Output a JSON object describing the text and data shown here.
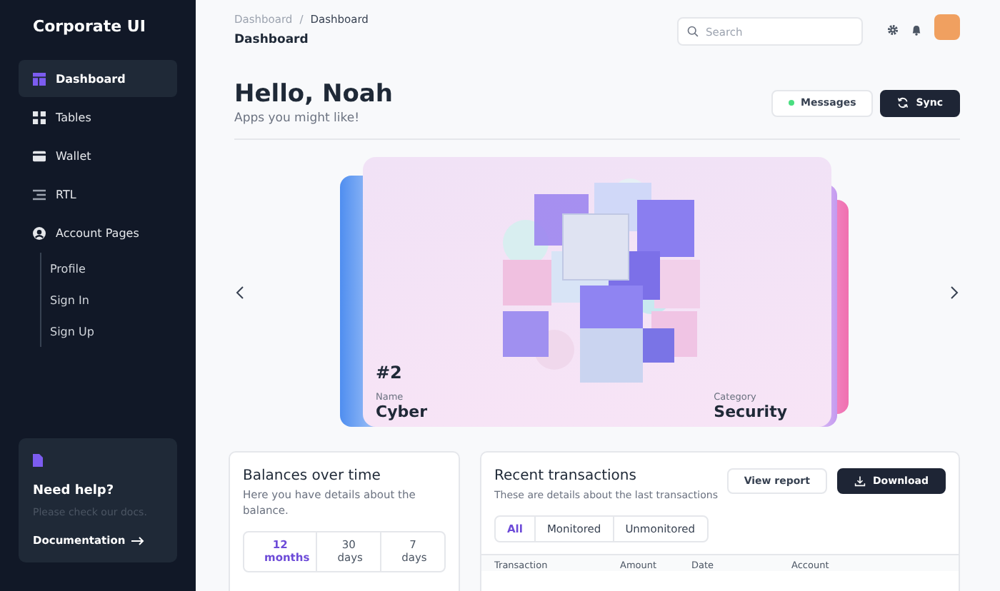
{
  "sidebar": {
    "brand": "Corporate UI",
    "items": [
      {
        "label": "Dashboard",
        "kind": "dashboard",
        "selected": true
      },
      {
        "label": "Tables",
        "kind": "tables",
        "selected": false
      },
      {
        "label": "Wallet",
        "kind": "wallet",
        "selected": false
      },
      {
        "label": "RTL",
        "kind": "rtl",
        "selected": false
      },
      {
        "label": "Account Pages",
        "kind": "account",
        "selected": false,
        "children": [
          {
            "label": "Profile",
            "selected": false
          },
          {
            "label": "Sign In",
            "selected": false
          },
          {
            "label": "Sign Up",
            "selected": false
          }
        ]
      }
    ],
    "help": {
      "title": "Need help?",
      "text": "Please check our docs.",
      "link": "Documentation"
    }
  },
  "header": {
    "breadcrumb": [
      "Dashboard",
      "Dashboard"
    ],
    "separator": "/",
    "title": "Dashboard",
    "search": {
      "placeholder": "Search"
    }
  },
  "greeting": {
    "title": "Hello, Noah",
    "subtitle": "Apps you might like!",
    "buttons": [
      {
        "label": "Messages",
        "kind": "status"
      },
      {
        "label": "Sync",
        "kind": "primary"
      }
    ]
  },
  "carousel": {
    "number": "#2",
    "name_label": "Name",
    "name": "Cyber",
    "category_label": "Category",
    "category": "Security"
  },
  "balances": {
    "title": "Balances over time",
    "subtitle": "Here you have details about the balance.",
    "ranges": [
      {
        "label": "12 months",
        "selected": true
      },
      {
        "label": "30 days",
        "selected": false
      },
      {
        "label": "7 days",
        "selected": false
      }
    ]
  },
  "transactions": {
    "title": "Recent transactions",
    "subtitle": "These are details about the last transactions",
    "buttons": [
      {
        "label": "View report",
        "kind": "secondary"
      },
      {
        "label": "Download",
        "kind": "primary"
      }
    ],
    "filters": [
      {
        "label": "All",
        "selected": true
      },
      {
        "label": "Monitored",
        "selected": false
      },
      {
        "label": "Unmonitored",
        "selected": false
      }
    ],
    "columns": [
      "Transaction",
      "Amount",
      "Date",
      "Account"
    ]
  }
}
